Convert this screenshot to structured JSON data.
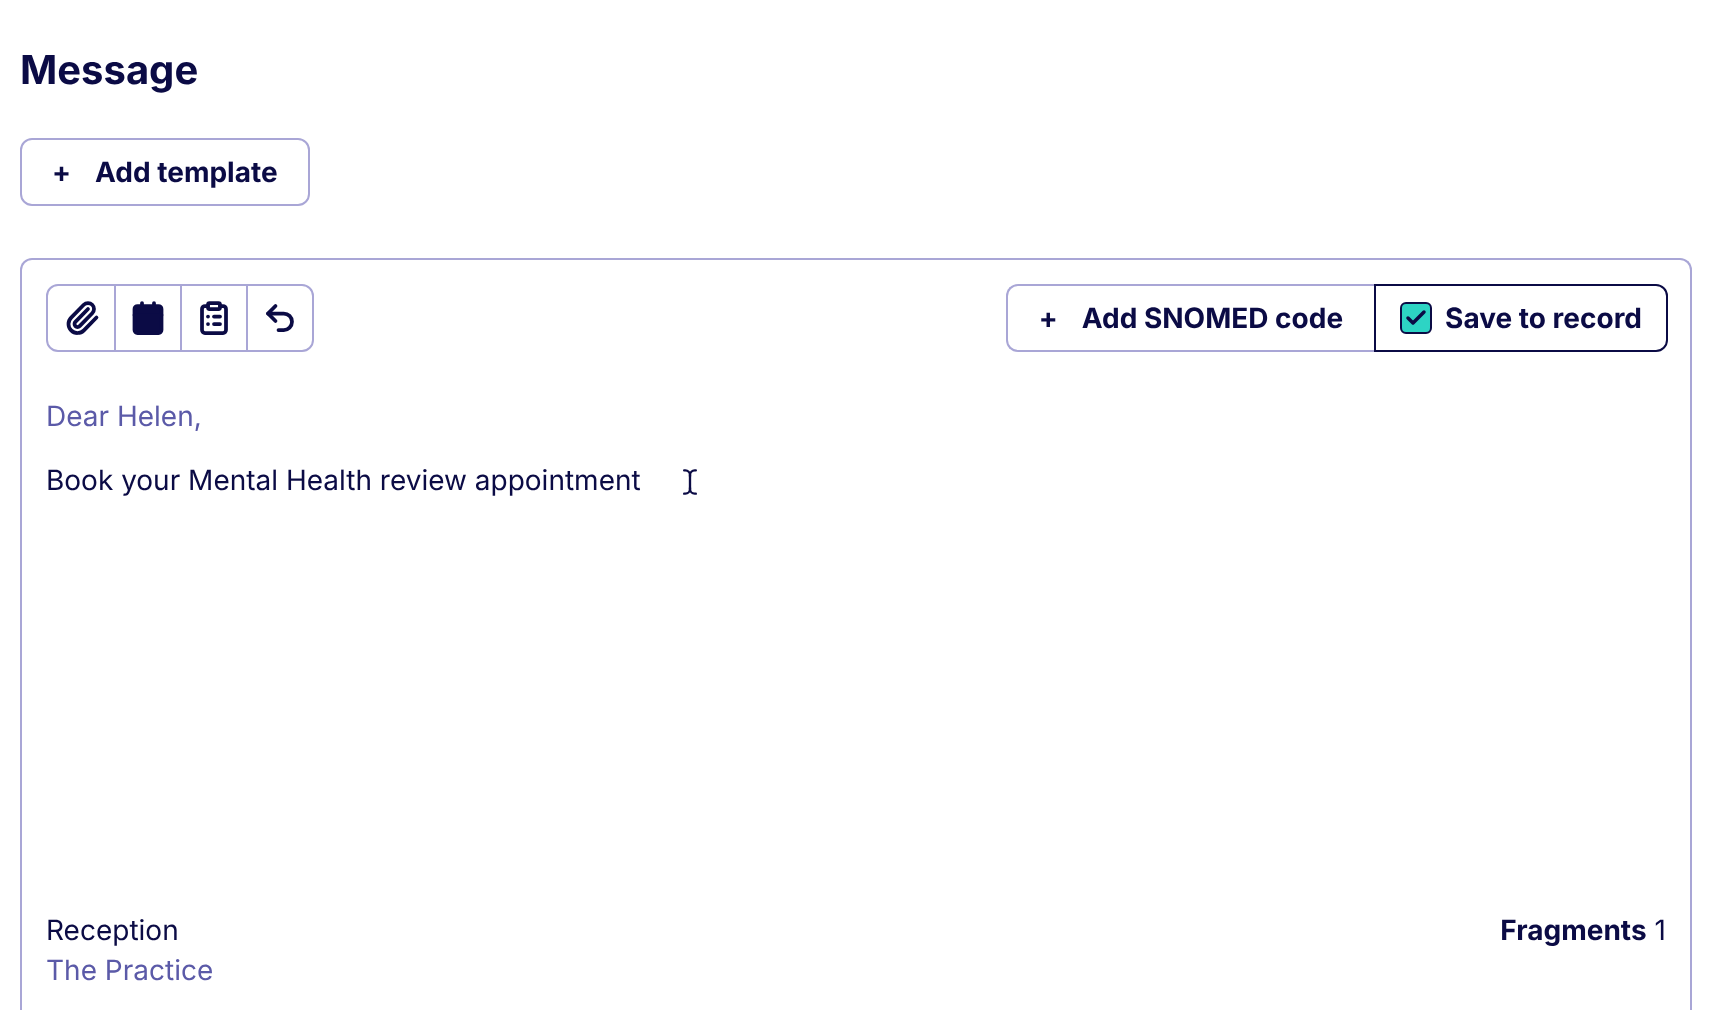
{
  "title": "Message",
  "add_template": {
    "icon": "+",
    "label": "Add template"
  },
  "add_snomed": {
    "icon": "+",
    "label": "Add SNOMED code"
  },
  "save_to_record": {
    "label": "Save to record",
    "checked": true
  },
  "greeting": "Dear Helen,",
  "body": "Book your Mental Health review appointment",
  "signature": [
    "Reception",
    "The Practice"
  ],
  "fragments": {
    "label": "Fragments",
    "value": "1"
  }
}
